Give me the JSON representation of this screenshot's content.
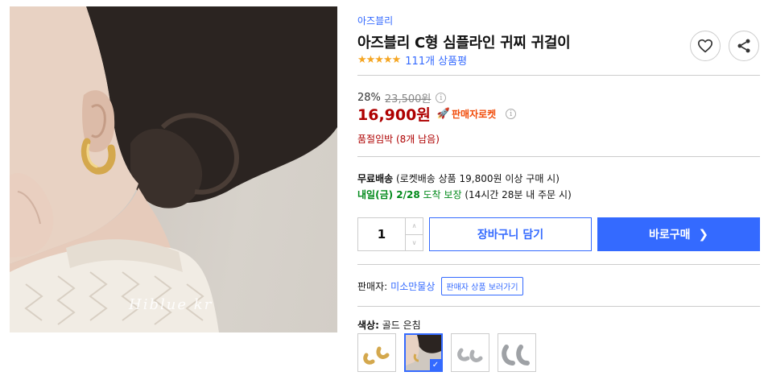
{
  "product": {
    "brand": "아즈블리",
    "title": "아즈블리 C형 심플라인 귀찌 귀걸이",
    "rating_stars": "★★★★★",
    "review_count": "111개 상품평",
    "watermark": "Hiblue kr"
  },
  "pricing": {
    "discount_rate": "28%",
    "original_price": "23,500원",
    "price": "16,900원",
    "rocket_badge": "판매자로켓",
    "stock_notice": "품절임박 (8개 남음)"
  },
  "shipping": {
    "free_label": "무료배송",
    "free_detail": " (로켓배송 상품 19,800원 이상 구매 시)",
    "arrival_day": "내일(금) 2/28",
    "arrival_guarantee": " 도착 보장",
    "arrival_detail": " (14시간 28분 내 주문 시)"
  },
  "purchase": {
    "quantity": "1",
    "cart_label": "장바구니 담기",
    "buy_label": "바로구매",
    "buy_chevron": "❯"
  },
  "seller": {
    "label": "판매자:",
    "name": "미소만물상",
    "link_label": "판매자 상품 보러가기"
  },
  "options": {
    "label": "색상:",
    "selected": "골드 은침",
    "check": "✓"
  },
  "colors": {
    "accent": "#346aff",
    "price": "#ae0000",
    "arrival": "#00891a",
    "rocket": "#f14b09",
    "star": "#f5a623"
  },
  "icons": {
    "heart": "heart-icon",
    "share": "share-icon",
    "info": "info-icon",
    "rocket": "rocket-icon"
  }
}
